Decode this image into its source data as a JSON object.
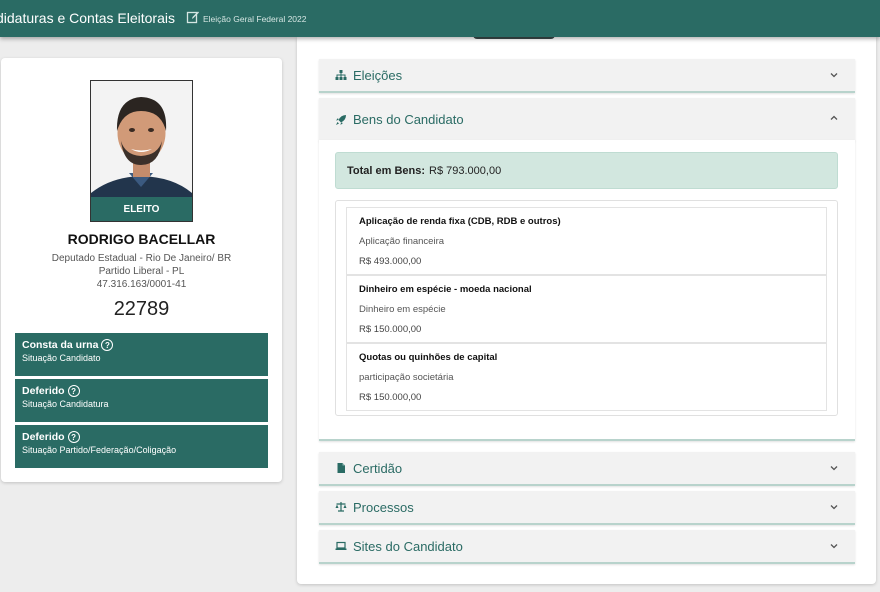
{
  "header": {
    "title": "didaturas e Contas Eleitorais",
    "subtitle": "Eleição Geral Federal 2022"
  },
  "candidate": {
    "badge": "ELEITO",
    "name": "RODRIGO BACELLAR",
    "office": "Deputado Estadual - Rio De Janeiro/ BR",
    "party": "Partido Liberal - PL",
    "cnpj": "47.316.163/0001-41",
    "number": "22789",
    "statuses": [
      {
        "title": "Consta da urna",
        "subtitle": "Situação Candidato"
      },
      {
        "title": "Deferido",
        "subtitle": "Situação Candidatura"
      },
      {
        "title": "Deferido",
        "subtitle": "Situação Partido/Federação/Coligação"
      }
    ]
  },
  "accordion": {
    "eleicoes": "Eleições",
    "bens": "Bens do Candidato",
    "certidao": "Certidão",
    "processos": "Processos",
    "sites": "Sites do Candidato"
  },
  "bens": {
    "total_label": "Total em Bens:",
    "total_value": "R$ 793.000,00",
    "items": [
      {
        "title": "Aplicação de renda fixa (CDB, RDB e outros)",
        "desc": "Aplicação financeira",
        "value": "R$ 493.000,00"
      },
      {
        "title": "Dinheiro em espécie - moeda nacional",
        "desc": "Dinheiro em espécie",
        "value": "R$ 150.000,00"
      },
      {
        "title": "Quotas ou quinhões de capital",
        "desc": "participação societária",
        "value": "R$ 150.000,00"
      }
    ]
  },
  "colors": {
    "primary": "#2a6b64",
    "total_bg": "#d2e7df"
  }
}
